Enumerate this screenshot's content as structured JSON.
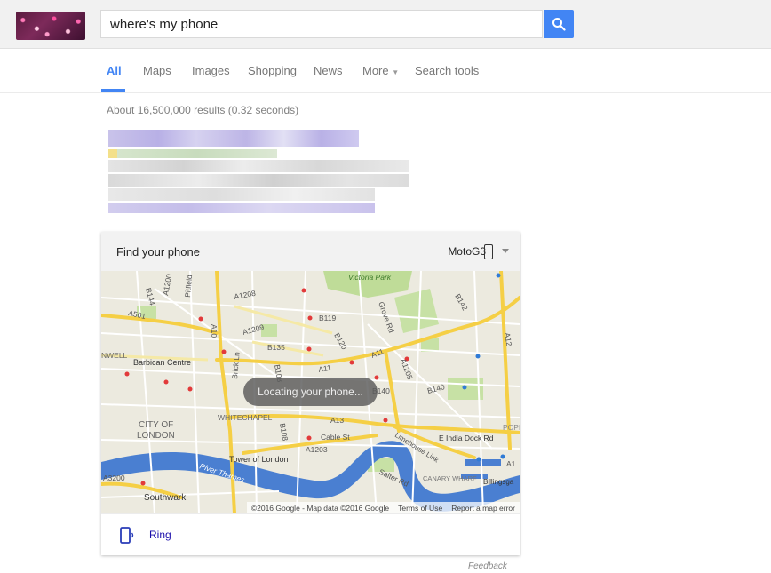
{
  "search": {
    "query": "where's my phone"
  },
  "tabs": {
    "items": [
      "All",
      "Maps",
      "Images",
      "Shopping",
      "News",
      "More",
      "Search tools"
    ],
    "active": "All"
  },
  "results": {
    "stats": "About 16,500,000 results (0.32 seconds)"
  },
  "find_phone": {
    "title": "Find your phone",
    "device": "MotoG3",
    "status": "Locating your phone...",
    "ring_label": "Ring"
  },
  "map": {
    "labels": {
      "victoria_park": "Victoria Park",
      "barbican": "Barbican Centre",
      "city_of_london_1": "CITY OF",
      "city_of_london_2": "LONDON",
      "whitechapel": "WHITECHAPEL",
      "tower": "Tower of London",
      "river": "River Thames",
      "southwark": "Southwark",
      "canary": "CANARY WHARF",
      "billingsgate": "Billingsga",
      "limehouse": "Limehouse Link",
      "india_dock": "E India Dock Rd",
      "cable_st": "Cable St",
      "well": "NWELL",
      "popl": "POPL",
      "a501": "A501",
      "a1208": "A1208",
      "a1209": "A1209",
      "a10": "A10",
      "a11_1": "A11",
      "a11_2": "A11",
      "a13": "A13",
      "a1203": "A1203",
      "a3200": "A3200",
      "a12": "A12",
      "a1205": "A1205",
      "b119": "B119",
      "b120": "B120",
      "b135": "B135",
      "b140": "B140",
      "b140b": "B140",
      "b108": "B108",
      "b142": "B142",
      "b144": "B144",
      "a1200": "A1200",
      "pitfield": "Pitfield",
      "grove_rd": "Grove Rd",
      "brick_ln": "Brick Ln",
      "salter_rd": "Salter Rd",
      "a17": "A1"
    },
    "footer": {
      "data": "©2016 Google - Map data ©2016 Google",
      "terms": "Terms of Use",
      "report": "Report a map error"
    }
  },
  "feedback": "Feedback",
  "colors": {
    "accent": "#4285f4",
    "link": "#1a0dab",
    "road_major": "#f5cf45",
    "water": "#4a7fd1",
    "park": "#b9d98e"
  }
}
